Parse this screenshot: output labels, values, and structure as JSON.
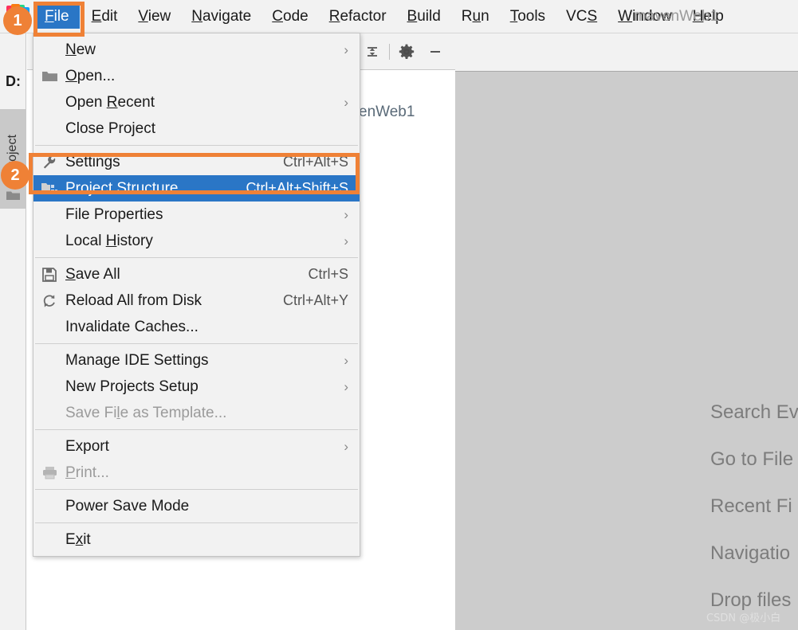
{
  "window": {
    "project_name": "mavenWeb1",
    "logo_icon": "intellij-idea-logo"
  },
  "menubar": {
    "items": [
      {
        "label": "File",
        "mnemonic": "F",
        "selected": true
      },
      {
        "label": "Edit",
        "mnemonic": "E",
        "selected": false
      },
      {
        "label": "View",
        "mnemonic": "V",
        "selected": false
      },
      {
        "label": "Navigate",
        "mnemonic": "N",
        "selected": false
      },
      {
        "label": "Code",
        "mnemonic": "C",
        "selected": false
      },
      {
        "label": "Refactor",
        "mnemonic": "R",
        "selected": false
      },
      {
        "label": "Build",
        "mnemonic": "B",
        "selected": false
      },
      {
        "label": "Run",
        "mnemonic": "u",
        "selected": false
      },
      {
        "label": "Tools",
        "mnemonic": "T",
        "selected": false
      },
      {
        "label": "VCS",
        "mnemonic": "S",
        "selected": false
      },
      {
        "label": "Window",
        "mnemonic": "W",
        "selected": false
      },
      {
        "label": "Help",
        "mnemonic": "H",
        "selected": false
      }
    ]
  },
  "file_menu": {
    "groups": [
      {
        "items": [
          {
            "label": "New",
            "mnemonic": "N",
            "shortcut": "",
            "arrow": true,
            "icon": "",
            "state": "normal"
          },
          {
            "label": "Open...",
            "mnemonic": "O",
            "shortcut": "",
            "arrow": false,
            "icon": "folder-icon",
            "state": "normal"
          },
          {
            "label": "Open Recent",
            "mnemonic": "R",
            "shortcut": "",
            "arrow": true,
            "icon": "",
            "state": "normal"
          },
          {
            "label": "Close Project",
            "mnemonic": "",
            "shortcut": "",
            "arrow": false,
            "icon": "",
            "state": "normal"
          }
        ]
      },
      {
        "items": [
          {
            "label": "Settings",
            "mnemonic": "",
            "shortcut": "Ctrl+Alt+S",
            "arrow": false,
            "icon": "wrench-icon",
            "state": "normal"
          },
          {
            "label": "Project Structure...",
            "mnemonic": "",
            "shortcut": "Ctrl+Alt+Shift+S",
            "arrow": false,
            "icon": "project-structure-icon",
            "state": "highlight"
          },
          {
            "label": "File Properties",
            "mnemonic": "",
            "shortcut": "",
            "arrow": true,
            "icon": "",
            "state": "normal"
          },
          {
            "label": "Local History",
            "mnemonic": "H",
            "shortcut": "",
            "arrow": true,
            "icon": "",
            "state": "normal"
          }
        ]
      },
      {
        "items": [
          {
            "label": "Save All",
            "mnemonic": "S",
            "shortcut": "Ctrl+S",
            "arrow": false,
            "icon": "save-icon",
            "state": "normal"
          },
          {
            "label": "Reload All from Disk",
            "mnemonic": "",
            "shortcut": "Ctrl+Alt+Y",
            "arrow": false,
            "icon": "reload-icon",
            "state": "normal"
          },
          {
            "label": "Invalidate Caches...",
            "mnemonic": "",
            "shortcut": "",
            "arrow": false,
            "icon": "",
            "state": "normal"
          }
        ]
      },
      {
        "items": [
          {
            "label": "Manage IDE Settings",
            "mnemonic": "",
            "shortcut": "",
            "arrow": true,
            "icon": "",
            "state": "normal"
          },
          {
            "label": "New Projects Setup",
            "mnemonic": "",
            "shortcut": "",
            "arrow": true,
            "icon": "",
            "state": "normal"
          },
          {
            "label": "Save File as Template...",
            "mnemonic": "l",
            "shortcut": "",
            "arrow": false,
            "icon": "",
            "state": "disabled"
          }
        ]
      },
      {
        "items": [
          {
            "label": "Export",
            "mnemonic": "",
            "shortcut": "",
            "arrow": true,
            "icon": "",
            "state": "normal"
          },
          {
            "label": "Print...",
            "mnemonic": "P",
            "shortcut": "",
            "arrow": false,
            "icon": "printer-icon",
            "state": "disabled"
          }
        ]
      },
      {
        "items": [
          {
            "label": "Power Save Mode",
            "mnemonic": "",
            "shortcut": "",
            "arrow": false,
            "icon": "",
            "state": "normal"
          }
        ]
      },
      {
        "items": [
          {
            "label": "Exit",
            "mnemonic": "x",
            "shortcut": "",
            "arrow": false,
            "icon": "",
            "state": "normal"
          }
        ]
      }
    ]
  },
  "left_strip": {
    "drive_label": "D:",
    "project_tab_label": "Project",
    "project_tab_icon": "folder-icon"
  },
  "project_panel": {
    "tree_root_label": "enWeb1",
    "toolbar_icons": [
      {
        "name": "collapse-all-icon"
      },
      {
        "name": "gear-icon"
      },
      {
        "name": "minimize-icon"
      }
    ]
  },
  "editor": {
    "hints": [
      "Search Ev",
      "Go to File",
      "Recent Fi",
      "Navigatio",
      "Drop files"
    ],
    "watermark": "CSDN @极小白",
    "background_color": "#cccccc"
  },
  "annotations": {
    "accent_color": "#ef8136",
    "steps": [
      {
        "number": "1",
        "target": "file-menu-button"
      },
      {
        "number": "2",
        "target": "project-structure-menu-item"
      }
    ]
  }
}
